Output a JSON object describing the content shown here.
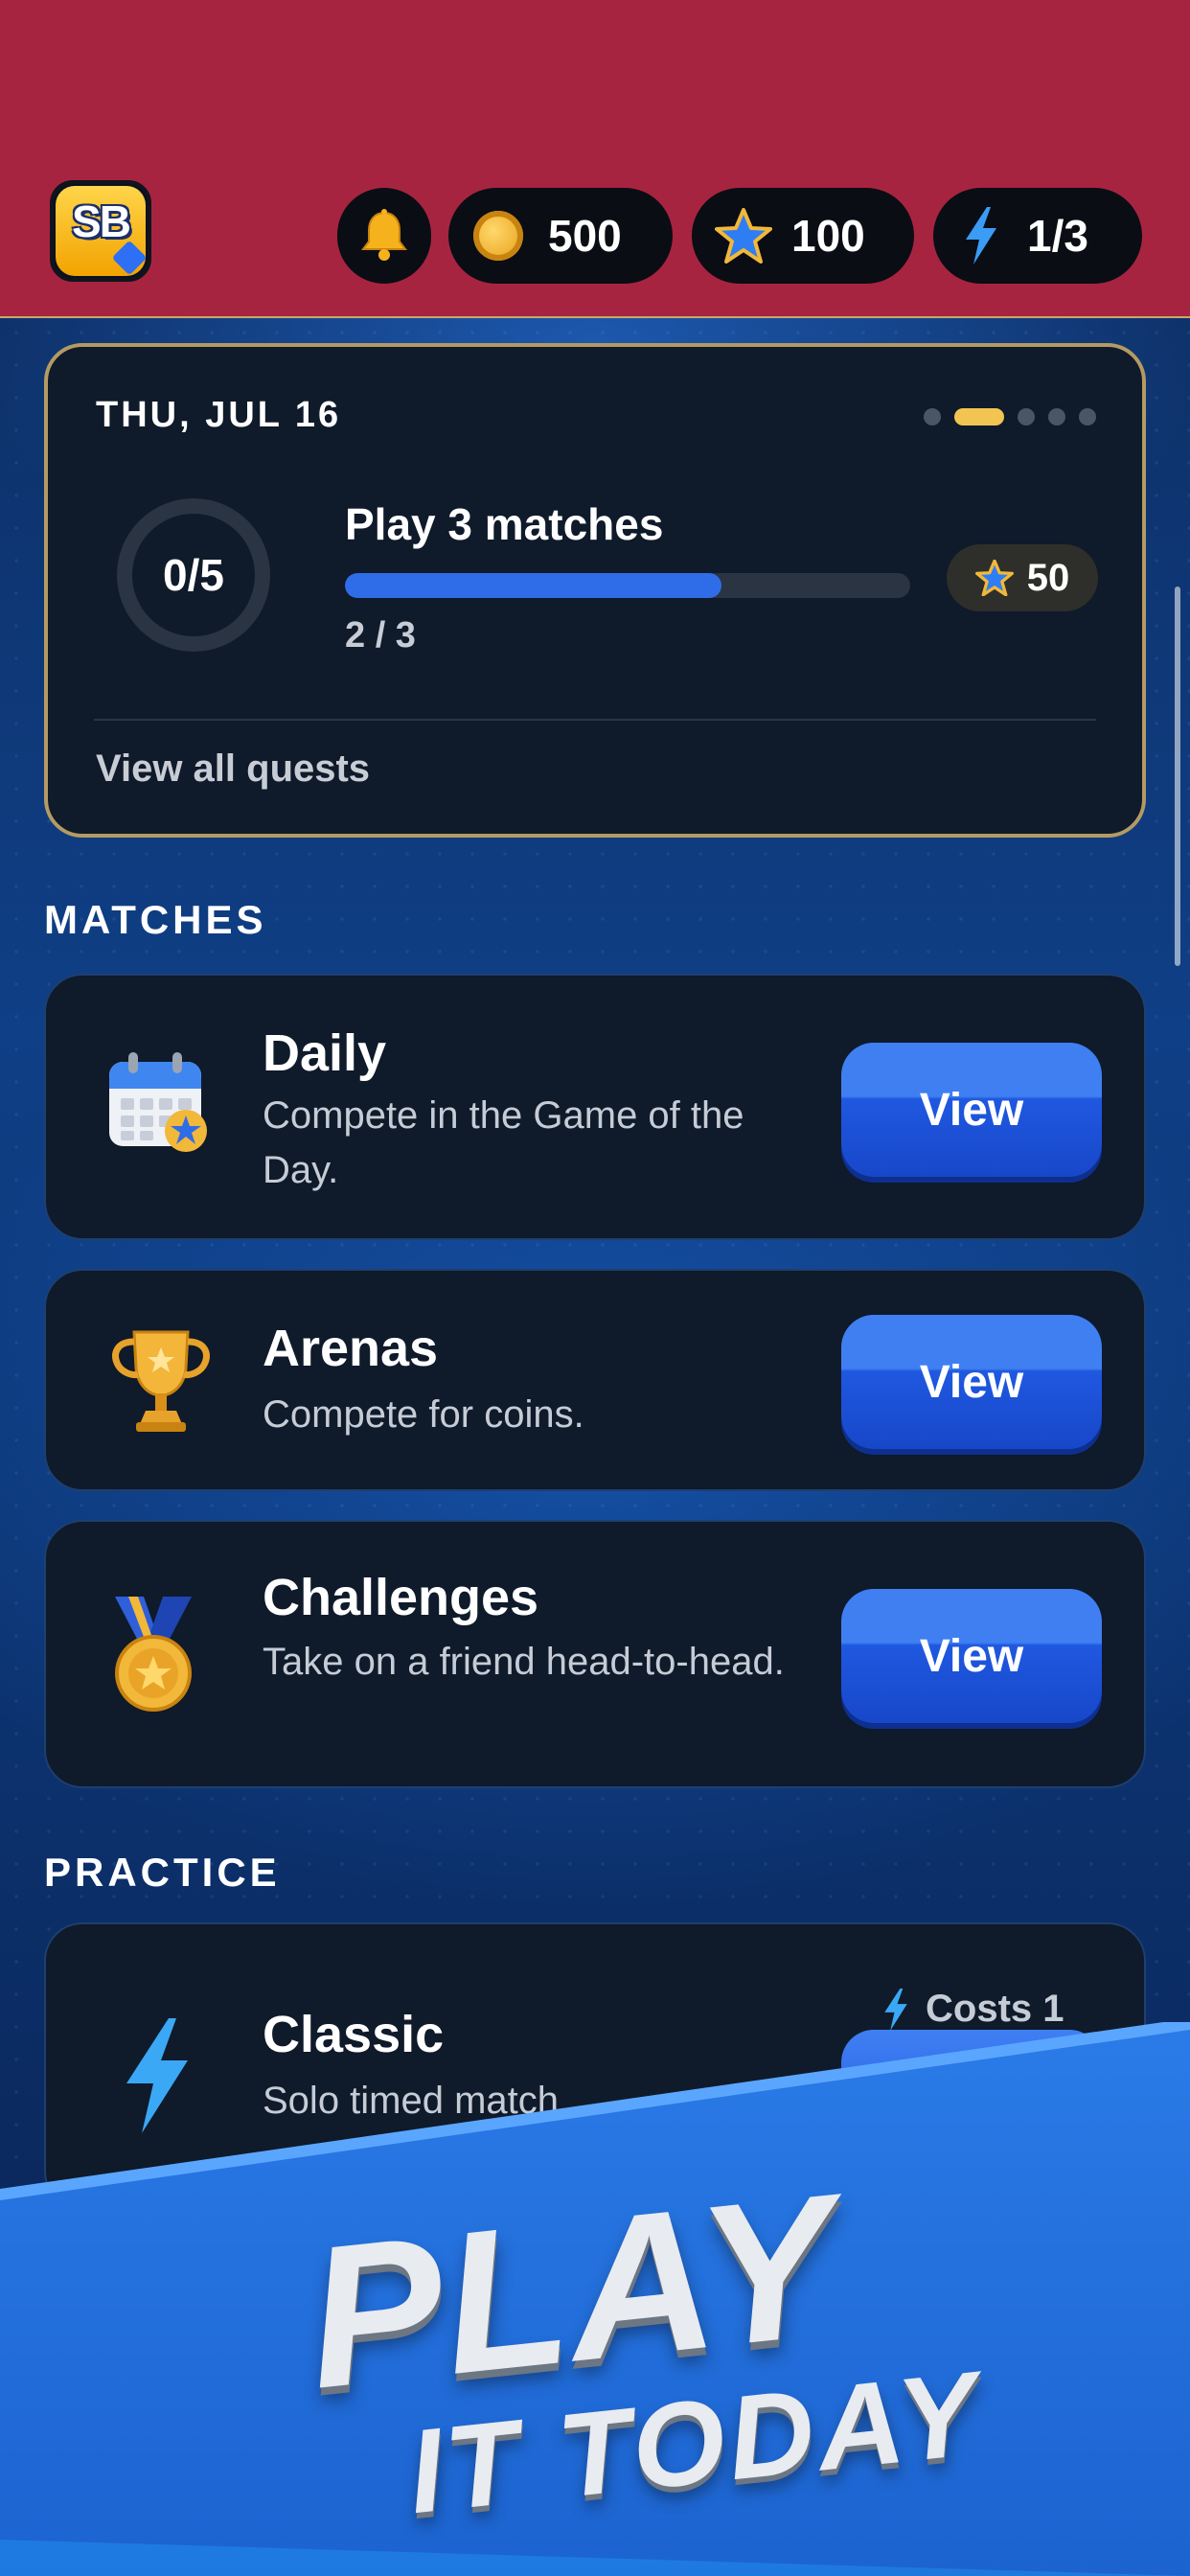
{
  "colors": {
    "header_bg": "#a72441",
    "accent_blue": "#2f6de8",
    "gold": "#f2c553",
    "card_bg": "#0f1a2a"
  },
  "header": {
    "logo_text": "SB",
    "coins": "500",
    "stars": "100",
    "energy": "1/3",
    "icons": [
      "bell-icon",
      "coin-icon",
      "star-icon",
      "lightning-icon"
    ]
  },
  "quest": {
    "date": "THU, JUL 16",
    "pager_active_index": 1,
    "pager_count": 5,
    "ring_label": "0/5",
    "title": "Play 3 matches",
    "progress_fraction": 0.6667,
    "progress_text": "2 / 3",
    "reward": "50",
    "view_all": "View all quests"
  },
  "sections": {
    "matches": "MATCHES",
    "practice": "PRACTICE"
  },
  "matches": [
    {
      "icon": "calendar-icon",
      "title": "Daily",
      "desc": "Compete in the Game of the Day.",
      "button": "View"
    },
    {
      "icon": "trophy-icon",
      "title": "Arenas",
      "desc": "Compete for coins.",
      "button": "View"
    },
    {
      "icon": "medal-icon",
      "title": "Challenges",
      "desc": "Take on a friend head-to-head.",
      "button": "View"
    }
  ],
  "practice": {
    "icon": "lightning-icon",
    "title": "Classic",
    "desc": "Solo timed match",
    "costs": "Costs 1"
  },
  "promo": {
    "line1": "PLAY",
    "line2": "IT TODAY"
  }
}
